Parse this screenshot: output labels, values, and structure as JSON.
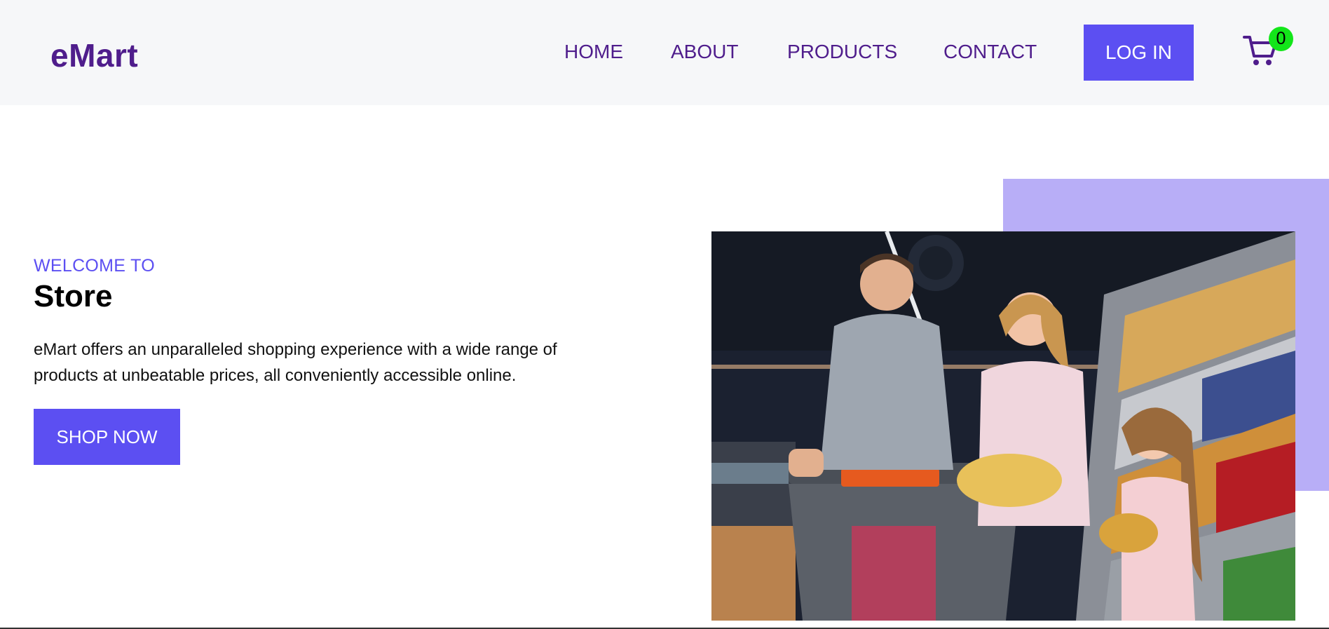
{
  "header": {
    "logo": "eMart",
    "nav": {
      "home": "HOME",
      "about": "ABOUT",
      "products": "PRODUCTS",
      "contact": "CONTACT"
    },
    "login_label": "LOG IN",
    "cart_count": "0"
  },
  "hero": {
    "eyebrow": "WELCOME TO",
    "title": "Store",
    "description": "eMart offers an unparalleled shopping experience with a wide range of products at unbeatable prices, all conveniently accessible online.",
    "cta_label": "SHOP NOW",
    "image_icon": "family-shopping-photo"
  },
  "colors": {
    "brand_purple": "#4f1d8c",
    "accent": "#5c4ff2",
    "accent_light": "#b8aef7",
    "header_bg": "#f6f7f9",
    "cart_badge": "#13e61a"
  }
}
